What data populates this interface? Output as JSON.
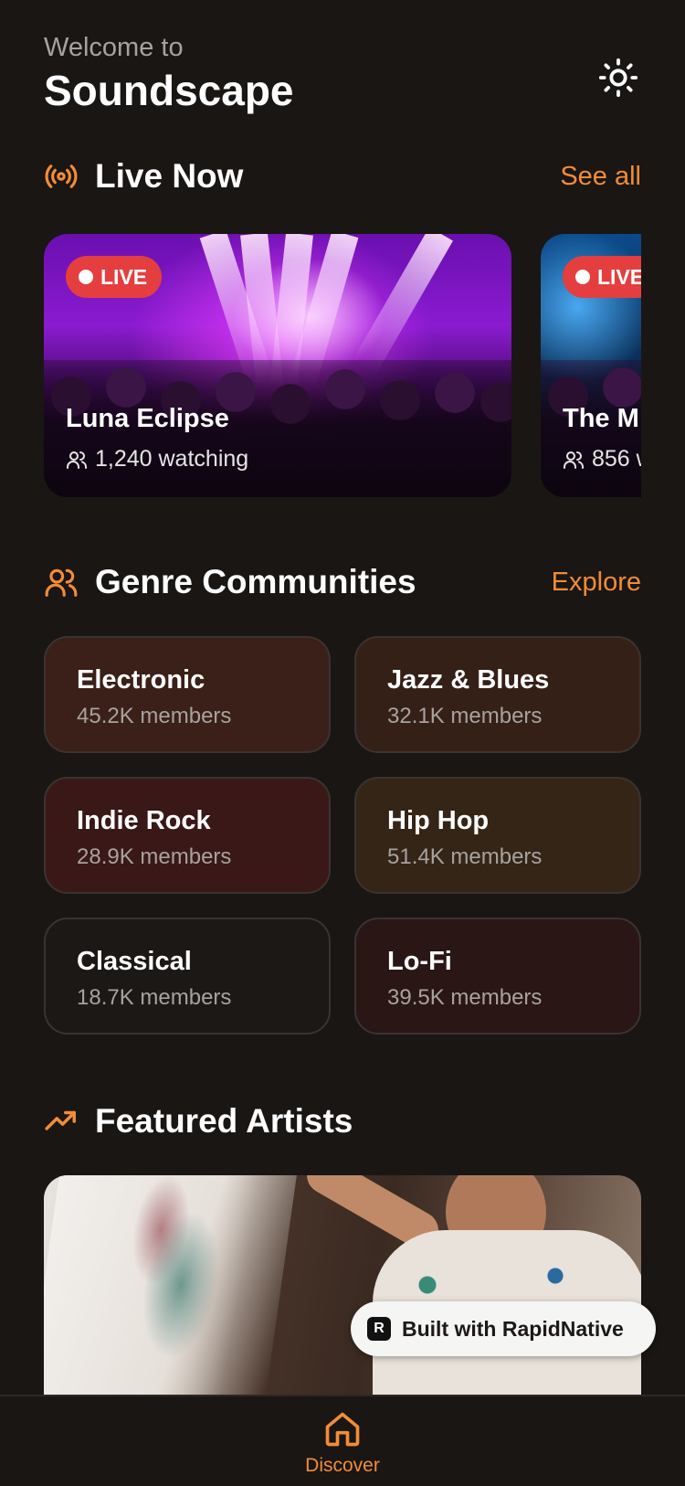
{
  "header": {
    "welcome": "Welcome to",
    "app_name": "Soundscape"
  },
  "live": {
    "title": "Live Now",
    "link": "See all",
    "cards": [
      {
        "badge": "LIVE",
        "name": "Luna Eclipse",
        "watching": "1,240 watching"
      },
      {
        "badge": "LIVE",
        "name": "The M",
        "watching": "856 w"
      }
    ]
  },
  "genres": {
    "title": "Genre Communities",
    "link": "Explore",
    "items": [
      {
        "name": "Electronic",
        "members": "45.2K members",
        "color": "#3a2018"
      },
      {
        "name": "Jazz & Blues",
        "members": "32.1K members",
        "color": "#352018"
      },
      {
        "name": "Indie Rock",
        "members": "28.9K members",
        "color": "#3a1818"
      },
      {
        "name": "Hip Hop",
        "members": "51.4K members",
        "color": "#352517"
      },
      {
        "name": "Classical",
        "members": "18.7K members",
        "color": "#1c1816"
      },
      {
        "name": "Lo-Fi",
        "members": "39.5K members",
        "color": "#2a1615"
      }
    ]
  },
  "featured": {
    "title": "Featured Artists"
  },
  "badge": {
    "text": "Built with RapidNative"
  },
  "tabbar": {
    "discover": "Discover"
  },
  "colors": {
    "accent": "#f28c38",
    "live": "#e53e3e",
    "background": "#1a1614"
  }
}
